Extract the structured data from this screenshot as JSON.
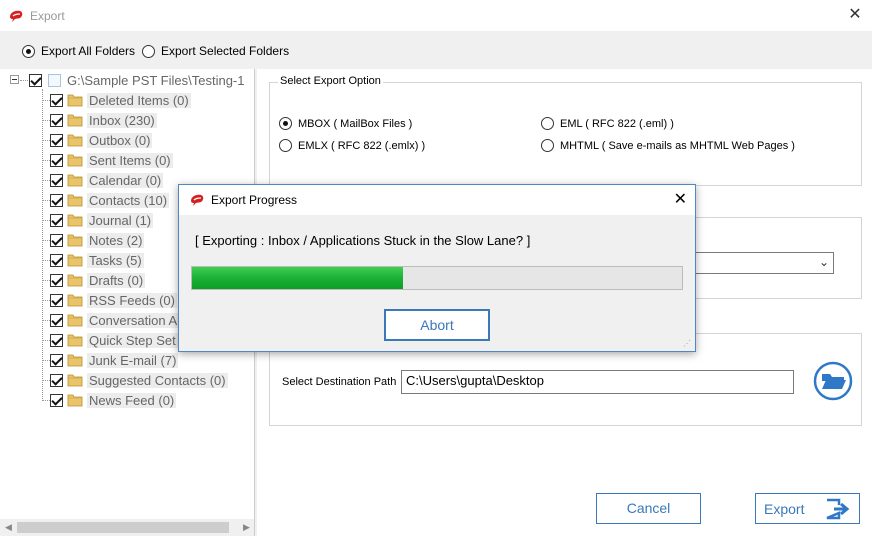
{
  "window": {
    "title": "Export"
  },
  "folder_mode": {
    "options": [
      {
        "label": "Export All Folders",
        "selected": true
      },
      {
        "label": "Export Selected Folders",
        "selected": false
      }
    ]
  },
  "tree": {
    "root": "G:\\Sample PST Files\\Testing-1",
    "items": [
      {
        "label": "Deleted Items (0)",
        "checked": true
      },
      {
        "label": "Inbox (230)",
        "checked": true
      },
      {
        "label": "Outbox (0)",
        "checked": true
      },
      {
        "label": "Sent Items (0)",
        "checked": true
      },
      {
        "label": "Calendar (0)",
        "checked": true
      },
      {
        "label": "Contacts (10)",
        "checked": true
      },
      {
        "label": "Journal (1)",
        "checked": true
      },
      {
        "label": "Notes (2)",
        "checked": true
      },
      {
        "label": "Tasks (5)",
        "checked": true
      },
      {
        "label": "Drafts (0)",
        "checked": true
      },
      {
        "label": "RSS Feeds (0)",
        "checked": true
      },
      {
        "label": "Conversation A",
        "checked": true
      },
      {
        "label": "Quick Step Set",
        "checked": true
      },
      {
        "label": "Junk E-mail (7)",
        "checked": true
      },
      {
        "label": "Suggested Contacts (0)",
        "checked": true
      },
      {
        "label": "News Feed (0)",
        "checked": true
      }
    ]
  },
  "export_option": {
    "title": "Select Export Option",
    "options": [
      {
        "label": "MBOX ( MailBox Files )",
        "selected": true
      },
      {
        "label": "EML ( RFC 822 (.eml) )",
        "selected": false
      },
      {
        "label": "EMLX ( RFC 822 (.emlx) )",
        "selected": false
      },
      {
        "label": "MHTML ( Save e-mails as MHTML Web Pages )",
        "selected": false
      }
    ]
  },
  "destination": {
    "label": "Select Destination Path",
    "value": "C:\\Users\\gupta\\Desktop"
  },
  "buttons": {
    "cancel": "Cancel",
    "export": "Export"
  },
  "progress_dialog": {
    "title": "Export Progress",
    "message": "[ Exporting : Inbox / Applications Stuck in the Slow Lane? ]",
    "progress_fraction": 0.43,
    "abort_label": "Abort"
  },
  "colors": {
    "accent": "#3a78b8",
    "progress": "#1fb33a"
  }
}
